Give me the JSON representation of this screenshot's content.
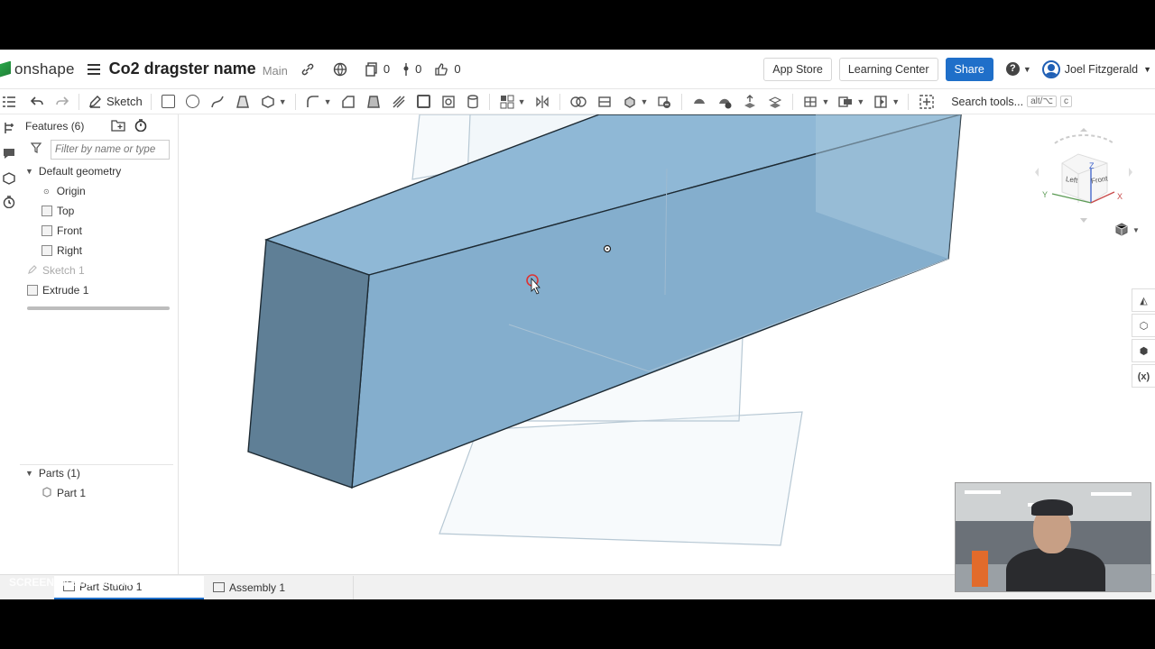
{
  "header": {
    "logo_text": "onshape",
    "doc_title": "Co2 dragster name",
    "branch": "Main",
    "count_docs": "0",
    "count_versions": "0",
    "count_likes": "0",
    "app_store": "App Store",
    "learning_center": "Learning Center",
    "share": "Share",
    "help": "?",
    "user_name": "Joel Fitzgerald"
  },
  "toolbar": {
    "sketch_label": "Sketch",
    "search_label": "Search tools...",
    "shortcut_1": "alt/⌥",
    "shortcut_2": "c"
  },
  "features": {
    "title": "Features (6)",
    "filter_placeholder": "Filter by name or type",
    "default_geometry": "Default geometry",
    "items": [
      {
        "label": "Origin"
      },
      {
        "label": "Top"
      },
      {
        "label": "Front"
      },
      {
        "label": "Right"
      }
    ],
    "sketch": "Sketch 1",
    "extrude": "Extrude 1",
    "parts_title": "Parts (1)",
    "part": "Part 1"
  },
  "view_cube": {
    "left": "Left",
    "front": "Front",
    "z": "Z",
    "y": "Y",
    "x": "X"
  },
  "tabs": [
    {
      "label": "Part Studio 1"
    },
    {
      "label": "Assembly 1"
    }
  ],
  "watermark": {
    "line1": "RECORDED WITH",
    "line2": "SCREENCAST-O-MATIC"
  },
  "colors": {
    "accent": "#1f6fc9",
    "part_face_top": "#8fb8d6",
    "part_face_front": "#5f7f96"
  }
}
